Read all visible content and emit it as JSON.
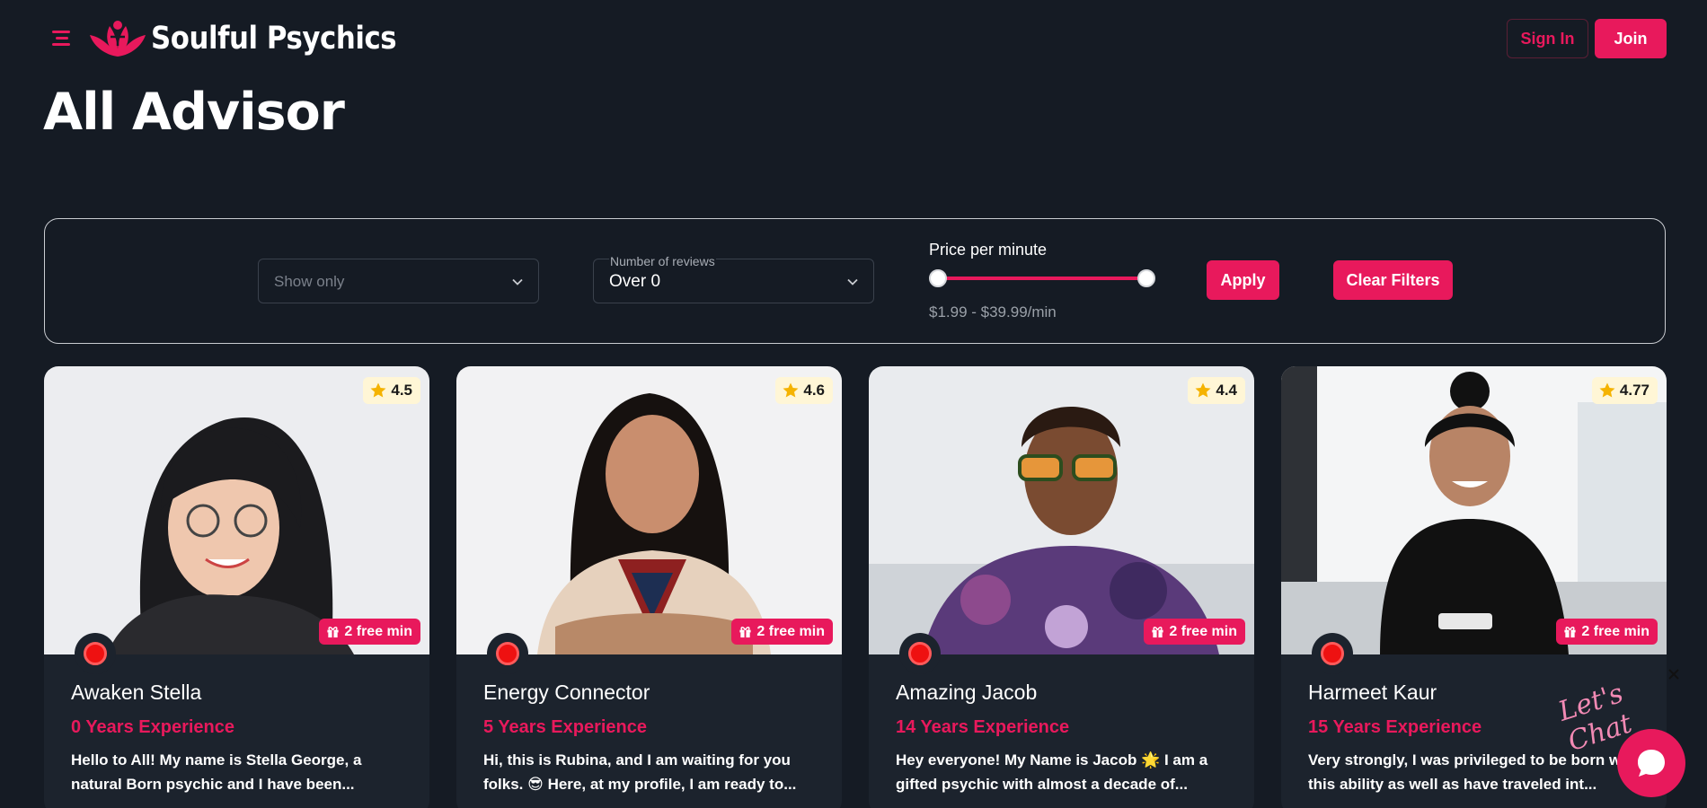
{
  "header": {
    "brand": "Soulful Psychics",
    "signin_label": "Sign In",
    "join_label": "Join"
  },
  "page": {
    "title": "All Advisor"
  },
  "filters": {
    "show_only": {
      "placeholder": "Show only"
    },
    "reviews": {
      "label": "Number of reviews",
      "value": "Over 0"
    },
    "price": {
      "label": "Price per minute",
      "range_text": "$1.99 - $39.99/min",
      "min_value": 1.99,
      "max_value": 39.99
    },
    "apply_label": "Apply",
    "clear_label": "Clear Filters"
  },
  "advisors": [
    {
      "name": "Awaken Stella",
      "rating": "4.5",
      "free": "2 free min",
      "experience": "0 Years Experience",
      "bio": "Hello to All! My name is Stella George, a natural Born psychic and I have been..."
    },
    {
      "name": "Energy Connector",
      "rating": "4.6",
      "free": "2 free min",
      "experience": "5 Years Experience",
      "bio": "Hi, this is Rubina, and I am waiting for you folks. 😎 Here, at my profile, I am ready to..."
    },
    {
      "name": "Amazing Jacob",
      "rating": "4.4",
      "free": "2 free min",
      "experience": "14 Years Experience",
      "bio": "Hey everyone! My Name is Jacob 🌟 I am a gifted psychic with almost a decade of..."
    },
    {
      "name": "Harmeet Kaur",
      "rating": "4.77",
      "free": "2 free min",
      "experience": "15 Years Experience",
      "bio": "Very strongly, I was privileged to be born with this ability as well as have traveled int..."
    }
  ],
  "chat": {
    "label": "Let's Chat"
  },
  "colors": {
    "accent": "#e8195c",
    "background": "#151b24",
    "card": "#1c232d",
    "rating_bg": "#fff6d6"
  },
  "icons": [
    "menu-icon",
    "lotus-logo-icon",
    "chevron-down-icon",
    "star-icon",
    "gift-icon",
    "online-status-icon",
    "close-icon",
    "chat-bubble-icon"
  ]
}
